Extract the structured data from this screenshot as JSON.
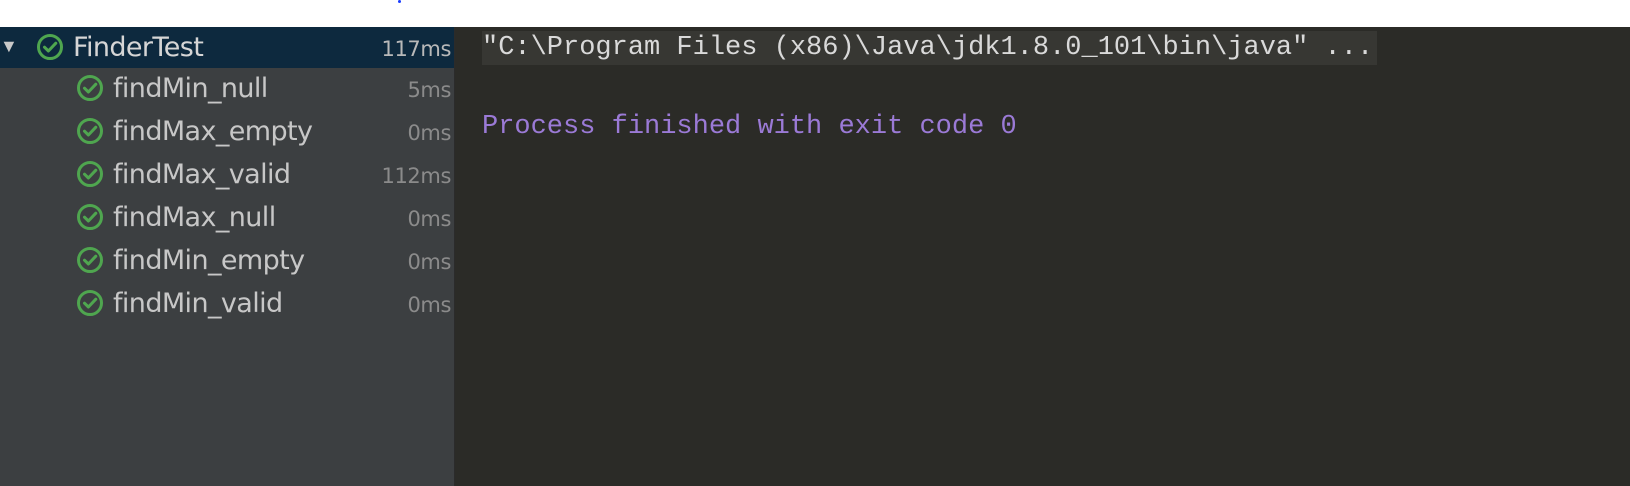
{
  "test_tree": {
    "root": {
      "label": "FinderTest",
      "time": "117ms",
      "status_icon": "check-circle-icon",
      "expand_icon": "triangle-down-icon"
    },
    "children": [
      {
        "label": "findMin_null",
        "time": "5ms",
        "status_icon": "check-circle-icon"
      },
      {
        "label": "findMax_empty",
        "time": "0ms",
        "status_icon": "check-circle-icon"
      },
      {
        "label": "findMax_valid",
        "time": "112ms",
        "status_icon": "check-circle-icon"
      },
      {
        "label": "findMax_null",
        "time": "0ms",
        "status_icon": "check-circle-icon"
      },
      {
        "label": "findMin_empty",
        "time": "0ms",
        "status_icon": "check-circle-icon"
      },
      {
        "label": "findMin_valid",
        "time": "0ms",
        "status_icon": "check-circle-icon"
      }
    ]
  },
  "console": {
    "command": "\"C:\\Program Files (x86)\\Java\\jdk1.8.0_101\\bin\\java\" ...",
    "exit_message": "Process finished with exit code 0"
  },
  "colors": {
    "pass_green": "#4fa64f",
    "selection": "#0d293e",
    "tree_background": "#3c3f41",
    "console_background": "#2b2b27",
    "exit_text": "#9b7ad6"
  }
}
